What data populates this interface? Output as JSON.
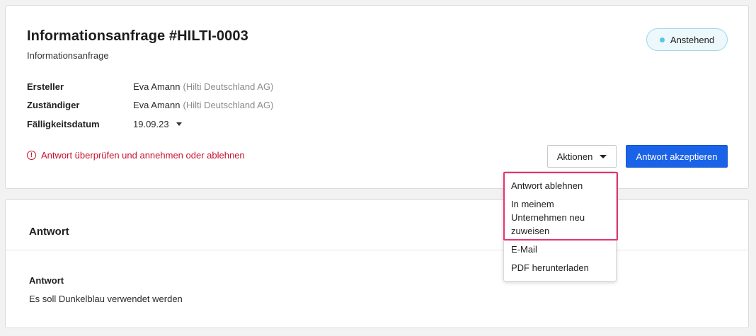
{
  "header": {
    "title": "Informationsanfrage #HILTI-0003",
    "subtitle": "Informationsanfrage",
    "status_label": "Anstehend"
  },
  "details": [
    {
      "label": "Ersteller",
      "value": "Eva Amann",
      "org": "(Hilti Deutschland AG)"
    },
    {
      "label": "Zuständiger",
      "value": "Eva Amann",
      "org": "(Hilti Deutschland AG)"
    },
    {
      "label": "Fälligkeitsdatum",
      "value": "19.09.23"
    }
  ],
  "warning": {
    "icon": "alert-circle-icon",
    "text": "Antwort überprüfen und annehmen oder ablehnen"
  },
  "actions": {
    "dropdown_label": "Aktionen",
    "accept_label": "Antwort akzeptieren",
    "menu_items": [
      "Antwort ablehnen",
      "In meinem Unternehmen neu zuweisen",
      "E-Mail",
      "PDF herunterladen"
    ]
  },
  "answer_section": {
    "title": "Antwort",
    "field_label": "Antwort",
    "field_value": "Es soll Dunkelblau verwendet werden"
  },
  "colors": {
    "primary": "#1a63e8",
    "warning": "#c8102e",
    "status_dot": "#5bc4e6",
    "highlight": "#e8326f"
  }
}
